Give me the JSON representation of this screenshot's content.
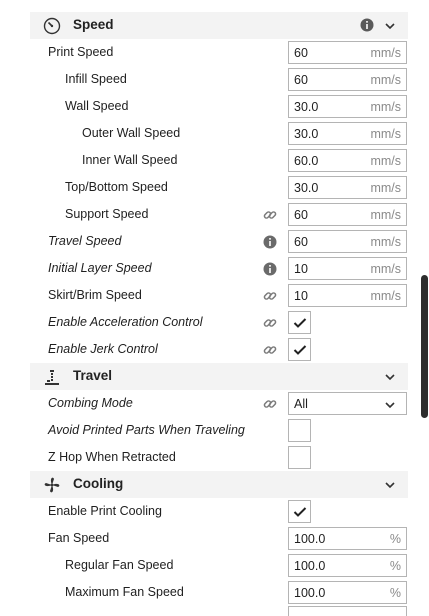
{
  "sections": {
    "speed": {
      "title": "Speed",
      "icon": "speedometer-icon",
      "settings": {
        "print_speed": {
          "label": "Print Speed",
          "value": "60",
          "unit": "mm/s"
        },
        "infill_speed": {
          "label": "Infill Speed",
          "value": "60",
          "unit": "mm/s"
        },
        "wall_speed": {
          "label": "Wall Speed",
          "value": "30.0",
          "unit": "mm/s"
        },
        "outer_wall_speed": {
          "label": "Outer Wall Speed",
          "value": "30.0",
          "unit": "mm/s"
        },
        "inner_wall_speed": {
          "label": "Inner Wall Speed",
          "value": "60.0",
          "unit": "mm/s"
        },
        "top_bottom_speed": {
          "label": "Top/Bottom Speed",
          "value": "30.0",
          "unit": "mm/s"
        },
        "support_speed": {
          "label": "Support Speed",
          "value": "60",
          "unit": "mm/s"
        },
        "travel_speed": {
          "label": "Travel Speed",
          "value": "60",
          "unit": "mm/s"
        },
        "initial_layer_speed": {
          "label": "Initial Layer Speed",
          "value": "10",
          "unit": "mm/s"
        },
        "skirt_brim_speed": {
          "label": "Skirt/Brim Speed",
          "value": "10",
          "unit": "mm/s"
        },
        "enable_acceleration_control": {
          "label": "Enable Acceleration Control",
          "checked": true
        },
        "enable_jerk_control": {
          "label": "Enable Jerk Control",
          "checked": true
        }
      }
    },
    "travel": {
      "title": "Travel",
      "icon": "travel-icon",
      "settings": {
        "combing_mode": {
          "label": "Combing Mode",
          "value": "All"
        },
        "avoid_printed_parts": {
          "label": "Avoid Printed Parts When Traveling",
          "checked": false
        },
        "z_hop_when_retracted": {
          "label": "Z Hop When Retracted",
          "checked": false
        }
      }
    },
    "cooling": {
      "title": "Cooling",
      "icon": "fan-icon",
      "settings": {
        "enable_print_cooling": {
          "label": "Enable Print Cooling",
          "checked": true
        },
        "fan_speed": {
          "label": "Fan Speed",
          "value": "100.0",
          "unit": "%"
        },
        "regular_fan_speed": {
          "label": "Regular Fan Speed",
          "value": "100.0",
          "unit": "%"
        },
        "maximum_fan_speed": {
          "label": "Maximum Fan Speed",
          "value": "100.0",
          "unit": "%"
        }
      }
    }
  }
}
